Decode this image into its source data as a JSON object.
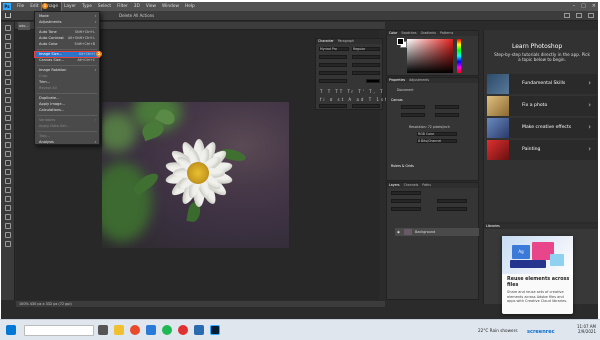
{
  "app": {
    "menu": [
      "File",
      "Edit",
      "Image",
      "Layer",
      "Type",
      "Select",
      "Filter",
      "3D",
      "View",
      "Window",
      "Help"
    ],
    "active_menu": "Image",
    "options_bar_text": "Delete All Actions",
    "document_tab": "ado...",
    "status_text": "100%     430 px x 332 px (72 ppi)",
    "window_controls": [
      "–",
      "□",
      "×"
    ],
    "logo": "Ps"
  },
  "image_menu": {
    "items": [
      {
        "label": "Mode",
        "shortcut": "",
        "submenu": true,
        "disabled": false
      },
      {
        "label": "Adjustments",
        "shortcut": "",
        "submenu": true,
        "disabled": false
      },
      {
        "label": "Auto Tone",
        "shortcut": "Shift+Ctrl+L",
        "submenu": false,
        "disabled": false
      },
      {
        "label": "Auto Contrast",
        "shortcut": "Alt+Shift+Ctrl+L",
        "submenu": false,
        "disabled": false
      },
      {
        "label": "Auto Color",
        "shortcut": "Shift+Ctrl+B",
        "submenu": false,
        "disabled": false
      },
      {
        "label": "Image Size...",
        "shortcut": "Alt+Ctrl+I",
        "submenu": false,
        "disabled": false,
        "highlighted": true
      },
      {
        "label": "Canvas Size...",
        "shortcut": "Alt+Ctrl+C",
        "submenu": false,
        "disabled": false
      },
      {
        "label": "Image Rotation",
        "shortcut": "",
        "submenu": true,
        "disabled": false
      },
      {
        "label": "Crop",
        "shortcut": "",
        "submenu": false,
        "disabled": true
      },
      {
        "label": "Trim...",
        "shortcut": "",
        "submenu": false,
        "disabled": false
      },
      {
        "label": "Reveal All",
        "shortcut": "",
        "submenu": false,
        "disabled": true
      },
      {
        "label": "Duplicate...",
        "shortcut": "",
        "submenu": false,
        "disabled": false
      },
      {
        "label": "Apply Image...",
        "shortcut": "",
        "submenu": false,
        "disabled": false
      },
      {
        "label": "Calculations...",
        "shortcut": "",
        "submenu": false,
        "disabled": false
      },
      {
        "label": "Variables",
        "shortcut": "",
        "submenu": true,
        "disabled": true
      },
      {
        "label": "Apply Data Set...",
        "shortcut": "",
        "submenu": false,
        "disabled": true
      },
      {
        "label": "Trap...",
        "shortcut": "",
        "submenu": false,
        "disabled": true
      },
      {
        "label": "Analysis",
        "shortcut": "",
        "submenu": true,
        "disabled": false
      }
    ],
    "badge_1": "1",
    "badge_2": "2"
  },
  "panels": {
    "character_tabs": [
      "Character",
      "Paragraph"
    ],
    "character_font": "Myriad Pro",
    "character_style": "Regular",
    "color_tabs": [
      "Color",
      "Swatches",
      "Gradients",
      "Patterns"
    ],
    "properties_tabs": [
      "Properties",
      "Adjustments"
    ],
    "properties_type": "Document",
    "canvas_label": "Canvas",
    "resolution": "Resolution: 72 pixels/inch",
    "mode": "RGB Color",
    "depth": "8 Bits/Channel",
    "rulers_label": "Rulers & Grids",
    "layers_tabs": [
      "Layers",
      "Channels",
      "Paths"
    ],
    "layer_name": "Background",
    "libraries_label": "Libraries"
  },
  "learn": {
    "title": "Learn Photoshop",
    "subtitle": "Step-by-step tutorials directly in the app. Pick a topic below to begin.",
    "cards": [
      {
        "label": "Fundamental Skills",
        "color": "#3a5a7a"
      },
      {
        "label": "Fix a photo",
        "color": "#c8a050"
      },
      {
        "label": "Make creative effects",
        "color": "#4a6a9a"
      },
      {
        "label": "Painting",
        "color": "#c83030"
      }
    ],
    "chevron": "›"
  },
  "libraries_popup": {
    "art_label": "Ag",
    "title": "Reuse elements across files",
    "body": "Share and reuse sets of creative elements across Adobe files and apps with Creative Cloud libraries."
  },
  "taskbar": {
    "weather": "22°C  Rain showers",
    "time": "11:07 AM",
    "date": "2/9/2021",
    "watermark": "screenrec"
  }
}
